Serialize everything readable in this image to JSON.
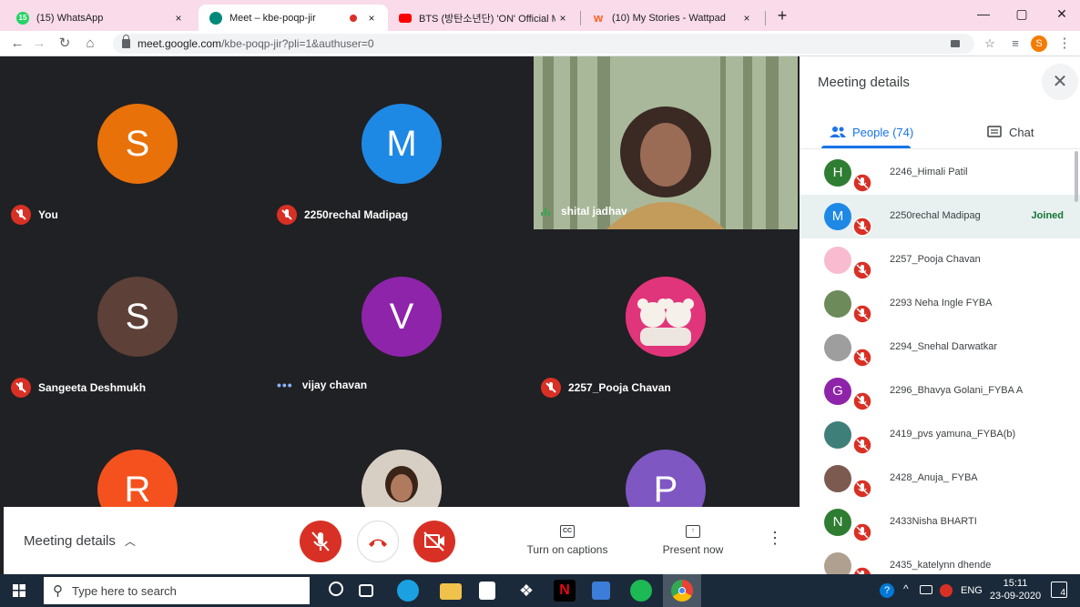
{
  "browser": {
    "tabs": [
      {
        "title": "(15) WhatsApp",
        "badge": "15",
        "color": "#25d366",
        "close": "×",
        "active": false
      },
      {
        "title": "Meet – kbe-poqp-jir",
        "badge": "",
        "color": "#00897b",
        "close": "×",
        "active": true
      },
      {
        "title": "BTS (방탄소년단) 'ON' Official MV",
        "badge": "",
        "color": "#ff0000",
        "close": "×",
        "active": false
      },
      {
        "title": "(10) My Stories - Wattpad",
        "badge": "",
        "color": "#ff6122",
        "close": "×",
        "active": false
      }
    ],
    "new_tab": "+",
    "window_controls": {
      "minimize": "—",
      "maximize": "▢",
      "close": "✕"
    },
    "url": {
      "host": "meet.google.com",
      "path": "/kbe-poqp-jir?pli=1&authuser=0"
    },
    "profile_initial": "S"
  },
  "tiles": [
    {
      "initial": "S",
      "color": "#e8710a",
      "name": "You",
      "status": "muted"
    },
    {
      "initial": "M",
      "color": "#1e88e5",
      "name": "2250rechal Madipag",
      "status": "muted"
    },
    {
      "initial": "",
      "color": "#8a9a6a",
      "name": "shital jadhav",
      "status": "speaking"
    },
    {
      "initial": "S",
      "color": "#5d4037",
      "name": "Sangeeta Deshmukh",
      "status": "muted"
    },
    {
      "initial": "V",
      "color": "#8e24aa",
      "name": "vijay chavan",
      "status": "dots"
    },
    {
      "initial": "",
      "color": "#e91e63",
      "name": "2257_Pooja Chavan",
      "status": "muted"
    },
    {
      "initial": "R",
      "color": "#f4511e",
      "name": "",
      "status": ""
    },
    {
      "initial": "",
      "color": "#c0a48a",
      "name": "",
      "status": ""
    },
    {
      "initial": "P",
      "color": "#7e57c2",
      "name": "",
      "status": ""
    }
  ],
  "bottom_bar": {
    "meeting_details": "Meeting details",
    "captions_label": "Turn on captions",
    "captions_icon": "CC",
    "present_label": "Present now",
    "more": "⋮"
  },
  "panel": {
    "title": "Meeting details",
    "close": "✕",
    "people_tab": "People (74)",
    "chat_tab": "Chat",
    "people": [
      {
        "initial": "H",
        "color": "#2e7d32",
        "name": "2246_Himali Patil",
        "status": "",
        "highlight": false
      },
      {
        "initial": "M",
        "color": "#1e88e5",
        "name": "2250rechal Madipag",
        "status": "Joined",
        "highlight": true
      },
      {
        "initial": "",
        "color": "#f8bbd0",
        "name": "2257_Pooja Chavan",
        "status": "",
        "highlight": false
      },
      {
        "initial": "",
        "color": "#6d8b5a",
        "name": "2293 Neha Ingle FYBA",
        "status": "",
        "highlight": false
      },
      {
        "initial": "",
        "color": "#9e9e9e",
        "name": "2294_Snehal Darwatkar",
        "status": "",
        "highlight": false
      },
      {
        "initial": "G",
        "color": "#8e24aa",
        "name": "2296_Bhavya Golani_FYBA A",
        "status": "",
        "highlight": false
      },
      {
        "initial": "",
        "color": "#3f7f7a",
        "name": "2419_pvs yamuna_FYBA(b)",
        "status": "",
        "highlight": false
      },
      {
        "initial": "",
        "color": "#7d5a4f",
        "name": "2428_Anuja_ FYBA",
        "status": "",
        "highlight": false
      },
      {
        "initial": "N",
        "color": "#2e7d32",
        "name": "2433Nisha BHARTI",
        "status": "",
        "highlight": false
      },
      {
        "initial": "",
        "color": "#b0a090",
        "name": "2435_katelynn dhende",
        "status": "",
        "highlight": false
      }
    ]
  },
  "taskbar": {
    "search_placeholder": "Type here to search",
    "lang": "ENG",
    "time": "15:11",
    "date": "23-09-2020",
    "notifications": "4"
  }
}
